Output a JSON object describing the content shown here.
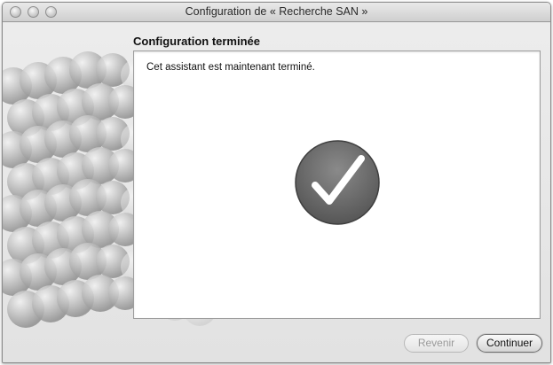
{
  "window": {
    "title": "Configuration de « Recherche SAN »"
  },
  "page": {
    "section_title": "Configuration terminée",
    "message": "Cet assistant est maintenant terminé."
  },
  "buttons": {
    "back_label": "Revenir",
    "continue_label": "Continuer"
  },
  "icons": {
    "hero_art": "sphere-cluster-icon",
    "status": "checkmark-icon"
  },
  "colors": {
    "window_bg": "#e6e6e6",
    "panel_bg": "#ffffff",
    "badge": "#6a6a6a",
    "check": "#ffffff"
  }
}
